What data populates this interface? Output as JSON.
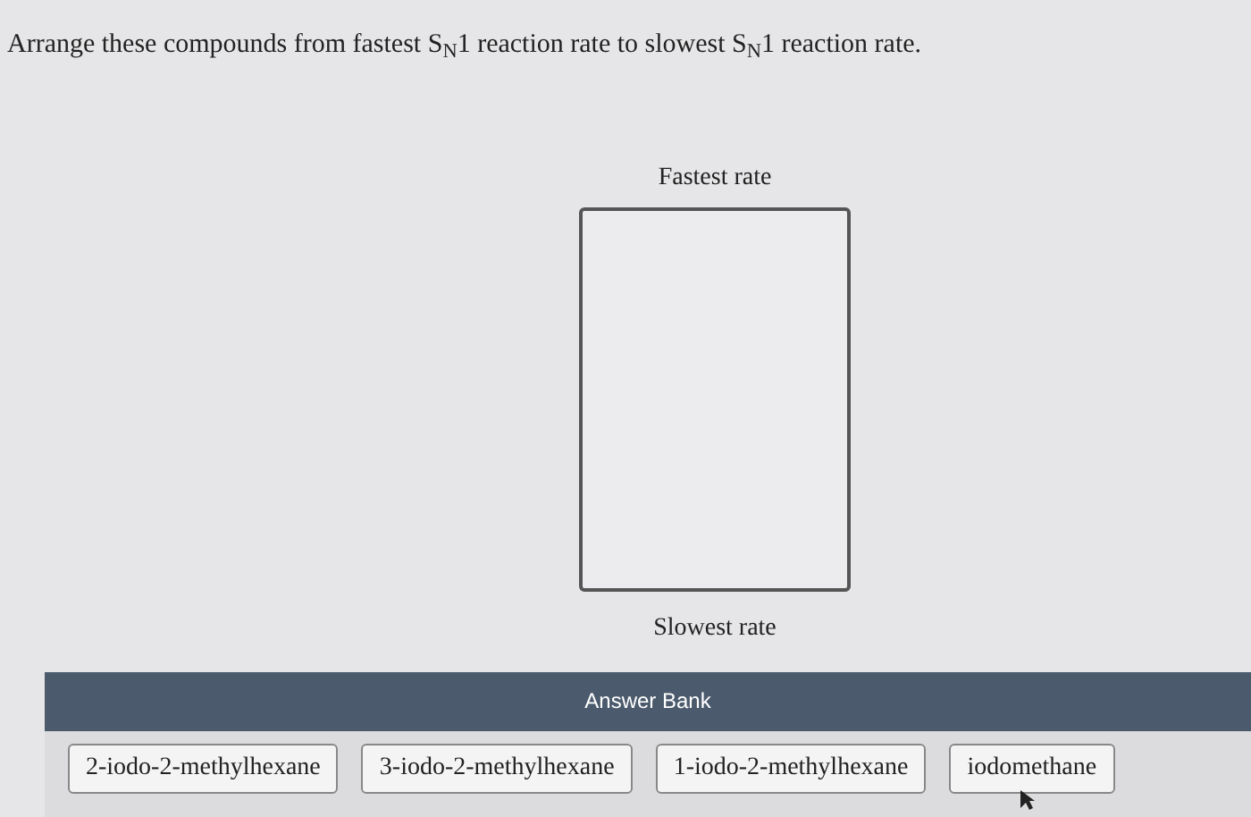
{
  "instruction": "Arrange these compounds from fastest S$_{N}$1 reaction rate to slowest S$_{N}$1 reaction rate.",
  "ranking": {
    "top_label": "Fastest rate",
    "bottom_label": "Slowest rate"
  },
  "answer_bank": {
    "title": "Answer Bank",
    "items": [
      {
        "label": "2-iodo-2-methylhexane"
      },
      {
        "label": "3-iodo-2-methylhexane"
      },
      {
        "label": "1-iodo-2-methylhexane"
      },
      {
        "label": "iodomethane"
      }
    ]
  }
}
